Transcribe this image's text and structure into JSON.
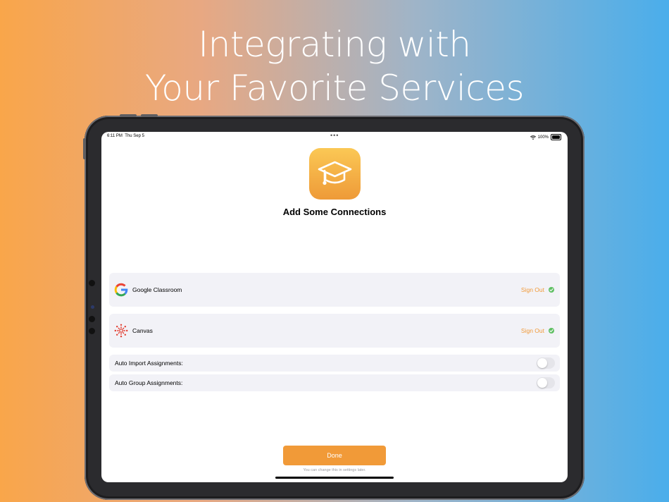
{
  "headline": {
    "line1": "Integrating with",
    "line2": "Your Favorite Services"
  },
  "status_bar": {
    "time": "6:11 PM",
    "date": "Thu Sep 5",
    "battery": "100%"
  },
  "onboarding": {
    "title": "Add Some Connections",
    "connections": [
      {
        "name": "Google Classroom",
        "action": "Sign Out",
        "connected": true,
        "icon": "google-icon"
      },
      {
        "name": "Canvas",
        "action": "Sign Out",
        "connected": true,
        "icon": "canvas-icon"
      }
    ],
    "toggles": [
      {
        "label": "Auto Import Assignments:",
        "on": false
      },
      {
        "label": "Auto Group Assignments:",
        "on": false
      }
    ],
    "done_label": "Done",
    "footnote": "You can change this in settings later."
  },
  "colors": {
    "accent": "#F19A38",
    "check": "#5FBF63",
    "card": "#F2F2F7"
  }
}
